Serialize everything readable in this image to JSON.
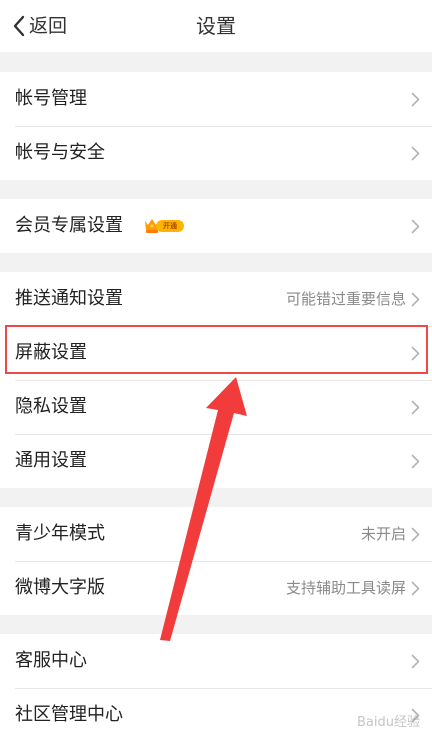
{
  "header": {
    "back_label": "返回",
    "title": "设置"
  },
  "rows": {
    "account_management": {
      "label": "帐号管理"
    },
    "account_security": {
      "label": "帐号与安全"
    },
    "vip_settings": {
      "label": "会员专属设置",
      "badge": "开通"
    },
    "push_settings": {
      "label": "推送通知设置",
      "value": "可能错过重要信息"
    },
    "block_settings": {
      "label": "屏蔽设置"
    },
    "privacy_settings": {
      "label": "隐私设置"
    },
    "general_settings": {
      "label": "通用设置"
    },
    "teen_mode": {
      "label": "青少年模式",
      "value": "未开启"
    },
    "large_font": {
      "label": "微博大字版",
      "value": "支持辅助工具读屏"
    },
    "customer_service": {
      "label": "客服中心"
    },
    "community_management": {
      "label": "社区管理中心"
    }
  },
  "watermark": "Baidu经验",
  "colors": {
    "background": "#f2f2f2",
    "highlight": "#ef4848",
    "badge": "#ffb400"
  }
}
